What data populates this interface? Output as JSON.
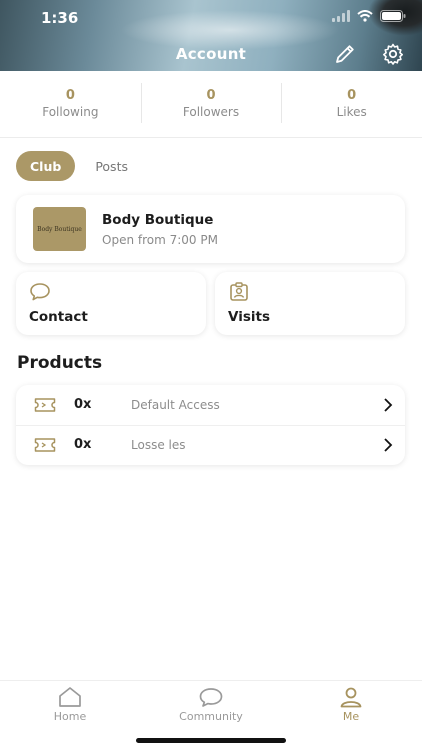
{
  "status_bar": {
    "time": "1:36"
  },
  "header": {
    "title": "Account"
  },
  "stats": [
    {
      "value": "0",
      "label": "Following"
    },
    {
      "value": "0",
      "label": "Followers"
    },
    {
      "value": "0",
      "label": "Likes"
    }
  ],
  "tabs": [
    {
      "label": "Club",
      "active": true
    },
    {
      "label": "Posts",
      "active": false
    }
  ],
  "club": {
    "logo_text": "Body Boutique",
    "name": "Body Boutique",
    "hours": "Open from 7:00 PM"
  },
  "actions": {
    "contact_label": "Contact",
    "visits_label": "Visits"
  },
  "products": {
    "title": "Products",
    "items": [
      {
        "qty": "0x",
        "name": "Default Access"
      },
      {
        "qty": "0x",
        "name": "Losse les"
      }
    ]
  },
  "nav": {
    "items": [
      {
        "label": "Home",
        "icon": "home-icon",
        "active": false
      },
      {
        "label": "Community",
        "icon": "chat-bubble-icon",
        "active": false
      },
      {
        "label": "Me",
        "icon": "user-icon",
        "active": true
      }
    ]
  },
  "colors": {
    "accent": "#ab9867",
    "accent_text": "#a7935f",
    "muted_text": "#8c8c8c"
  }
}
